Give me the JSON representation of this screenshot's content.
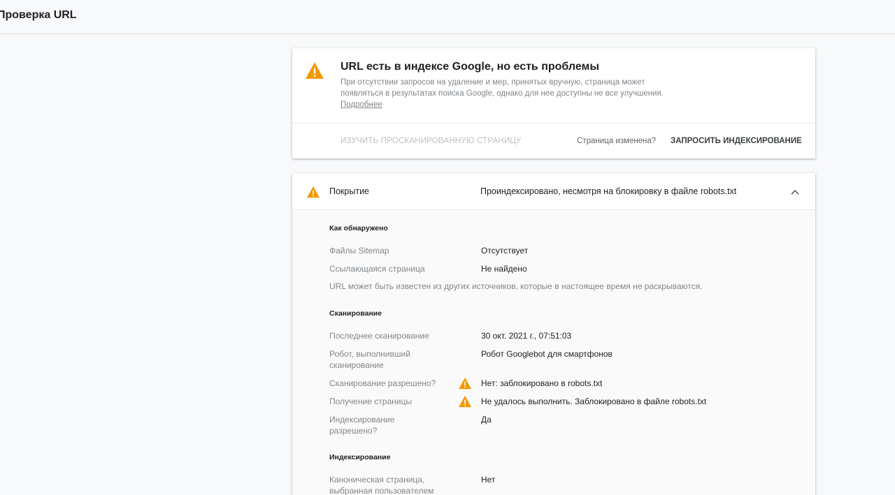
{
  "header": {
    "title": "Проверка URL"
  },
  "status": {
    "title": "URL есть в индексе Google, но есть проблемы",
    "description": "При отсутствии запросов на удаление и мер, принятых вручную, страница может появляться в результатах поиска Google, однако для нее доступны не все улучшения.",
    "more_link": "Подробнее",
    "inspect_crawled_label": "ИЗУЧИТЬ ПРОСКАНИРОВАННУЮ СТРАНИЦУ",
    "page_changed_question": "Страница изменена?",
    "request_indexing_label": "ЗАПРОСИТЬ ИНДЕКСИРОВАНИЕ"
  },
  "coverage": {
    "label": "Покрытие",
    "value": "Проиндексировано, несмотря на блокировку в файле robots.txt",
    "discovery": {
      "title": "Как обнаружено",
      "sitemaps_label": "Файлы Sitemap",
      "sitemaps_value": "Отсутствует",
      "referring_label": "Ссылающаяся страница",
      "referring_value": "Не найдено",
      "note": "URL может быть известен из других источников, которые в настоящее время не раскрываются."
    },
    "crawl": {
      "title": "Сканирование",
      "last_crawl_label": "Последнее сканирование",
      "last_crawl_value": "30 окт. 2021 г., 07:51:03",
      "crawled_as_label": "Робот, выполнивший сканирование",
      "crawled_as_value": "Робот Googlebot для смартфонов",
      "crawl_allowed_label": "Сканирование разрешено?",
      "crawl_allowed_value": "Нет: заблокировано в robots.txt",
      "page_fetch_label": "Получение страницы",
      "page_fetch_value": "Не удалось выполнить. Заблокировано в файле robots.txt",
      "indexing_allowed_label": "Индексирование разрешено?",
      "indexing_allowed_value": "Да"
    },
    "indexing": {
      "title": "Индексирование",
      "user_canonical_label": "Каноническая страница, выбранная пользователем",
      "user_canonical_value": "Нет"
    }
  },
  "colors": {
    "warning": "#f29900",
    "text": "#202124",
    "muted": "#80868b"
  },
  "icons": {
    "warning": "warning-triangle-icon",
    "collapse": "chevron-up-icon"
  }
}
